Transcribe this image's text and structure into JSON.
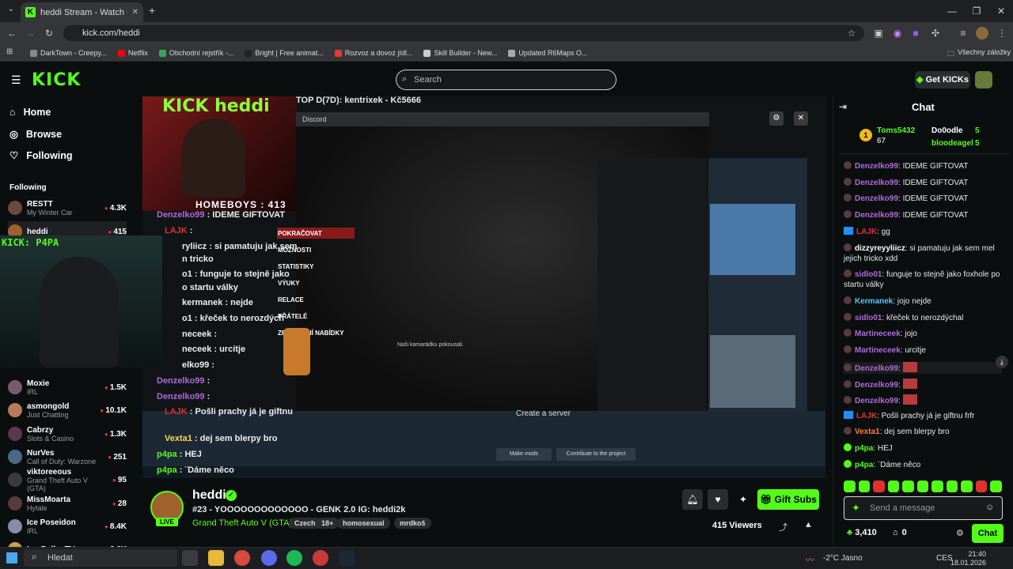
{
  "browser": {
    "tab_title": "heddi Stream - Watch Live",
    "url": "kick.com/heddi",
    "bookmarks": [
      {
        "label": "DarkTown - Creepy...",
        "color": "#888"
      },
      {
        "label": "Netflix",
        "color": "#e50914"
      },
      {
        "label": "Obchodní rejstřík -...",
        "color": "#34a853"
      },
      {
        "label": "Bright | Free animat...",
        "color": "#222"
      },
      {
        "label": "Rozvoz a dovoz jídl...",
        "color": "#e53935"
      },
      {
        "label": "Skill Builder - New...",
        "color": "#ccc"
      },
      {
        "label": "Updated R6Maps O...",
        "color": "#aaa"
      }
    ],
    "all_bookmarks": "Všechny záložky"
  },
  "header": {
    "logo": "KICK",
    "search_placeholder": "Search",
    "get_kicks": "Get KICKs"
  },
  "sidebar": {
    "nav": [
      {
        "label": "Home",
        "icon": "home-icon"
      },
      {
        "label": "Browse",
        "icon": "compass-icon"
      },
      {
        "label": "Following",
        "icon": "heart-icon"
      }
    ],
    "following_title": "Following",
    "channels": [
      {
        "name": "RESTT",
        "game": "My Winter Car",
        "viewers": "4.3K",
        "color": "#6b4a3a"
      },
      {
        "name": "heddi",
        "game": "",
        "viewers": "415",
        "color": "#a0622d"
      },
      {
        "name": "Moxie",
        "game": "IRL",
        "viewers": "1.5K",
        "color": "#7a5a6a"
      },
      {
        "name": "asmongold",
        "game": "Just Chatting",
        "viewers": "10.1K",
        "color": "#b87a5a"
      },
      {
        "name": "Cabrzy",
        "game": "Slots & Casino",
        "viewers": "1.3K",
        "color": "#5a3a4a"
      },
      {
        "name": "NurVes",
        "game": "Call of Duty: Warzone",
        "viewers": "251",
        "color": "#4a6a8a"
      },
      {
        "name": "viktoreeous",
        "game": "Grand Theft Auto V (GTA)",
        "viewers": "95",
        "color": "#3a3a3a"
      },
      {
        "name": "MissMoarta",
        "game": "Hytale",
        "viewers": "28",
        "color": "#5a3a3a"
      },
      {
        "name": "Ice Poseidon",
        "game": "IRL",
        "viewers": "8.4K",
        "color": "#8a8aaa"
      },
      {
        "name": "LosPollosTV",
        "game": "",
        "viewers": "6.6K",
        "color": "#c8a050"
      }
    ]
  },
  "stream_overlay": {
    "title_overlay": "KICK heddi",
    "top_donor": "TOP D(7D): kentrixek - Kč5666",
    "homeboys": "HOMEBOYS : 413",
    "discord": "Discord",
    "kick_p4pa": "KICK: P4PA",
    "game_menu": [
      "POKRAČOVAT",
      "MOŽNOSTI",
      "STATISTIKY",
      "VÝUKY",
      "RELACE",
      "PŘÁTELÉ",
      "ZPĚT ... VNÍ NABÍDKY"
    ],
    "subtitle": "Naši kamarádku pokousali.",
    "create_server": "Create a server",
    "make_mods": "Make mods",
    "contribute": "Contribute to the project",
    "overlay_chat": [
      {
        "user": "Denzelko99",
        "text": " : IDEME GIFTOVAT",
        "color": "#b06ad8"
      },
      {
        "user": "LAJK",
        "text": " :",
        "color": "#e03030"
      },
      {
        "user": "",
        "text": "ryliicz : si pamatuju jak sem",
        "color": "#ddd"
      },
      {
        "user": "",
        "text": "n tricko",
        "color": "#ddd"
      },
      {
        "user": "",
        "text": "o1 : funguje to stejně jako",
        "color": "#ddd"
      },
      {
        "user": "",
        "text": "o startu války",
        "color": "#ddd"
      },
      {
        "user": "",
        "text": "kermanek : nejde",
        "color": "#ddd"
      },
      {
        "user": "",
        "text": "o1 : křeček to nerozdých",
        "color": "#ddd"
      },
      {
        "user": "",
        "text": "neceek :",
        "color": "#ddd"
      },
      {
        "user": "",
        "text": "neceek : urcitje",
        "color": "#ddd"
      },
      {
        "user": "",
        "text": "elko99 :",
        "color": "#ddd"
      },
      {
        "user": "Denzelko99",
        "text": " :",
        "color": "#b06ad8"
      },
      {
        "user": "Denzelko99",
        "text": " :",
        "color": "#b06ad8"
      },
      {
        "user": "LAJK",
        "text": " : Pošli prachy já je giftnu",
        "color": "#e03030"
      },
      {
        "user": "Vexta1",
        "text": " : dej sem blerpy bro",
        "color": "#ffd84a"
      },
      {
        "user": "p4pa",
        "text": " : HEJ",
        "color": "#53fc18"
      },
      {
        "user": "p4pa",
        "text": " : ¨Dáme něco",
        "color": "#53fc18"
      }
    ]
  },
  "stream_info": {
    "channel": "heddi",
    "live": "LIVE",
    "title": "#23 - YOOOOOOOOOOOOO - GENK 2.0 IG: heddi2k",
    "category": "Grand Theft Auto V (GTA)",
    "tags": [
      "Czech",
      "18+",
      "homosexual",
      "mrdkoš"
    ],
    "gift_subs": "Gift Subs",
    "viewers": "415 Viewers"
  },
  "chat": {
    "title": "Chat",
    "leaderboard": [
      {
        "name": "Toms5432",
        "value": "67",
        "color": "#53fc18"
      },
      {
        "name": "Do0odle",
        "value": "5",
        "color": "#fff"
      },
      {
        "name": "bloodeagel",
        "value": "5",
        "color": "#53fc18"
      }
    ],
    "messages": [
      {
        "user": "Denzelko99",
        "text": ": IDEME GIFTOVAT",
        "color": "#b06ad8"
      },
      {
        "user": "Denzelko99",
        "text": ": IDEME GIFTOVAT",
        "color": "#b06ad8"
      },
      {
        "user": "Denzelko99",
        "text": ": IDEME GIFTOVAT",
        "color": "#b06ad8"
      },
      {
        "user": "Denzelko99",
        "text": ": IDEME GIFTOVAT",
        "color": "#b06ad8"
      },
      {
        "user": "LAJK",
        "text": ": gg",
        "color": "#e03030"
      },
      {
        "user": "dizzyreyyliicz",
        "text": ": si pamatuju jak sem mel jejich tricko xdd",
        "color": "#ffffff"
      },
      {
        "user": "sidlo01",
        "text": ": funguje to stejně jako foxhole po startu války",
        "color": "#b06ad8"
      },
      {
        "user": "Kermanek",
        "text": ": jojo nejde",
        "color": "#53c8fc"
      },
      {
        "user": "sidlo01",
        "text": ": křeček to nerozdýchal",
        "color": "#b06ad8"
      },
      {
        "user": "Martineceek",
        "text": ": jojo",
        "color": "#b06ad8"
      },
      {
        "user": "Martineceek",
        "text": ": urcitje",
        "color": "#b06ad8"
      },
      {
        "user": "Denzelko99",
        "text": ":",
        "color": "#b06ad8"
      },
      {
        "user": "Denzelko99",
        "text": ":",
        "color": "#b06ad8"
      },
      {
        "user": "Denzelko99",
        "text": ":",
        "color": "#b06ad8"
      },
      {
        "user": "LAJK",
        "text": ": Pošli prachy já je giftnu frfr",
        "color": "#e03030"
      },
      {
        "user": "Vexta1",
        "text": ": dej sem blerpy bro",
        "color": "#ff7b3a"
      },
      {
        "user": "p4pa",
        "text": ": HEJ",
        "color": "#53fc18"
      },
      {
        "user": "p4pa",
        "text": ": ¨Dáme něco",
        "color": "#53fc18"
      }
    ],
    "input_placeholder": "Send a message",
    "kicks_balance": "3,410",
    "subs_count": "0",
    "send": "Chat"
  },
  "taskbar": {
    "search": "Hledat",
    "weather": "-2°C  Jasno",
    "lang": "CES",
    "time": "21:40",
    "date": "18.01.2026"
  }
}
